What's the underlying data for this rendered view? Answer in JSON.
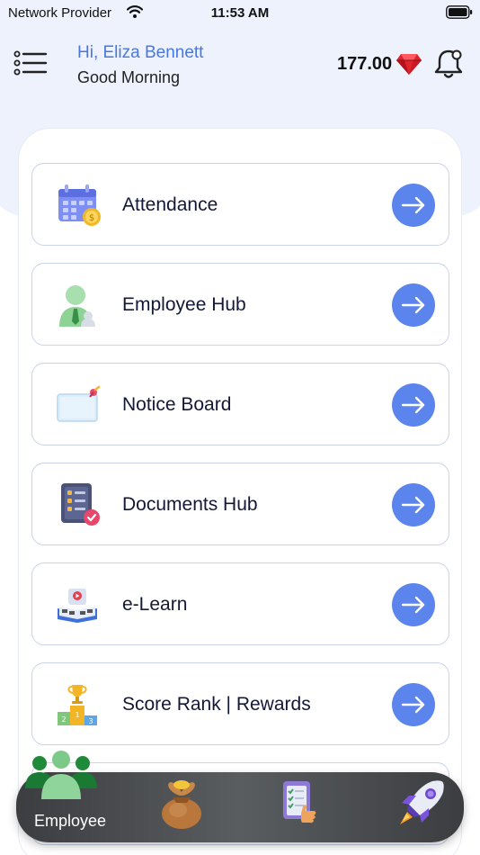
{
  "status_bar": {
    "carrier": "Network Provider",
    "time": "11:53 AM"
  },
  "header": {
    "greeting": "Hi, Eliza Bennett",
    "subgreeting": "Good Morning",
    "points": "177.00"
  },
  "menu": [
    {
      "label": "Attendance",
      "icon": "calendar-coin-icon"
    },
    {
      "label": "Employee Hub",
      "icon": "employee-avatar-icon"
    },
    {
      "label": "Notice Board",
      "icon": "notice-board-icon"
    },
    {
      "label": "Documents Hub",
      "icon": "documents-checklist-icon"
    },
    {
      "label": "e-Learn",
      "icon": "book-video-icon"
    },
    {
      "label": "Score Rank | Rewards",
      "icon": "podium-trophy-icon"
    }
  ],
  "bottom_nav": {
    "active_label": "Employee",
    "items": [
      "employee-group-icon",
      "money-bag-icon",
      "clipboard-thumbs-up-icon",
      "rocket-icon"
    ]
  },
  "colors": {
    "accent": "#5b85ec",
    "greeting": "#4a77e0",
    "background_top": "#eef2fd",
    "gem": "#e0242c"
  }
}
